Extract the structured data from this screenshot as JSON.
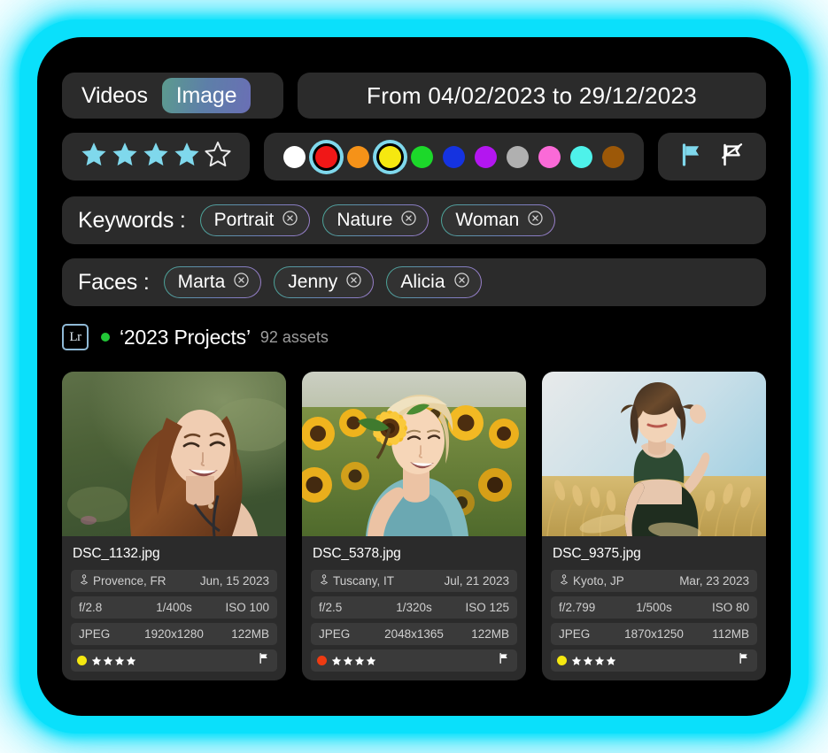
{
  "theme": {
    "glow_color": "#0ae0fb",
    "panel_bg": "#000000",
    "control_bg": "#2b2b2b",
    "accent_cyan": "#7fd8ec",
    "chip_gradient_from": "#4aa596",
    "chip_gradient_to": "#9a7ec9"
  },
  "media_type_toggle": {
    "name": "media-type-segmented-control",
    "options": [
      "Videos",
      "Image"
    ],
    "selected": "Image"
  },
  "date_range": {
    "prefix": "From",
    "start": "04/02/2023",
    "joiner": "to",
    "end": "29/12/2023",
    "full_text": "From 04/02/2023 to 29/12/2023"
  },
  "rating_filter": {
    "name": "star-rating-filter",
    "value": 4,
    "max": 5
  },
  "color_filter": {
    "name": "color-label-filter",
    "swatches": [
      {
        "label": "white",
        "hex": "#ffffff",
        "selected": false
      },
      {
        "label": "red",
        "hex": "#f01717",
        "selected": true
      },
      {
        "label": "orange",
        "hex": "#f59218",
        "selected": false
      },
      {
        "label": "yellow",
        "hex": "#f5e810",
        "selected": true
      },
      {
        "label": "green",
        "hex": "#1cd82a",
        "selected": false
      },
      {
        "label": "blue",
        "hex": "#1533e0",
        "selected": false
      },
      {
        "label": "purple",
        "hex": "#b316f0",
        "selected": false
      },
      {
        "label": "gray",
        "hex": "#b0b0b0",
        "selected": false
      },
      {
        "label": "pink",
        "hex": "#fa6ad7",
        "selected": false
      },
      {
        "label": "cyan",
        "hex": "#4ef2ea",
        "selected": false
      },
      {
        "label": "brown",
        "hex": "#9c5808",
        "selected": false
      }
    ]
  },
  "flag_filter": {
    "flagged": {
      "icon": "flag-icon",
      "state": "active",
      "color": "#7fd8ec"
    },
    "rejected": {
      "icon": "flag-rejected-icon",
      "state": "inactive",
      "color": "#ffffff"
    }
  },
  "keywords": {
    "label": "Keywords :",
    "chips": [
      "Portrait",
      "Nature",
      "Woman"
    ],
    "remove_icon": "close-circle-icon"
  },
  "faces": {
    "label": "Faces :",
    "chips": [
      "Marta",
      "Jenny",
      "Alicia"
    ],
    "remove_icon": "close-circle-icon"
  },
  "project": {
    "app_badge": "Lr",
    "status_color": "#22c637",
    "name": "‘2023 Projects’",
    "asset_count": "92 assets"
  },
  "cards": [
    {
      "filename": "DSC_1132.jpg",
      "location": "Provence, FR",
      "date": "Jun, 15 2023",
      "aperture": "f/2.8",
      "shutter": "1/400s",
      "iso": "ISO 100",
      "format": "JPEG",
      "dimensions": "1920x1280",
      "filesize": "122MB",
      "color_label": "#f5e810",
      "stars": 4,
      "flagged": true,
      "photo_alt": "Smiling woman with long auburn hair in a green meadow"
    },
    {
      "filename": "DSC_5378.jpg",
      "location": "Tuscany, IT",
      "date": "Jul, 21 2023",
      "aperture": "f/2.5",
      "shutter": "1/320s",
      "iso": "ISO 125",
      "format": "JPEG",
      "dimensions": "2048x1365",
      "filesize": "122MB",
      "color_label": "#ef3b12",
      "stars": 4,
      "flagged": true,
      "photo_alt": "Blonde woman holding a sunflower in a sunflower field"
    },
    {
      "filename": "DSC_9375.jpg",
      "location": "Kyoto, JP",
      "date": "Mar, 23 2023",
      "aperture": "f/2.799",
      "shutter": "1/500s",
      "iso": "ISO 80",
      "format": "JPEG",
      "dimensions": "1870x1250",
      "filesize": "112MB",
      "color_label": "#f5e810",
      "stars": 4,
      "flagged": true,
      "photo_alt": "Woman with dark bob hair in green crop top in a wheat field"
    }
  ]
}
